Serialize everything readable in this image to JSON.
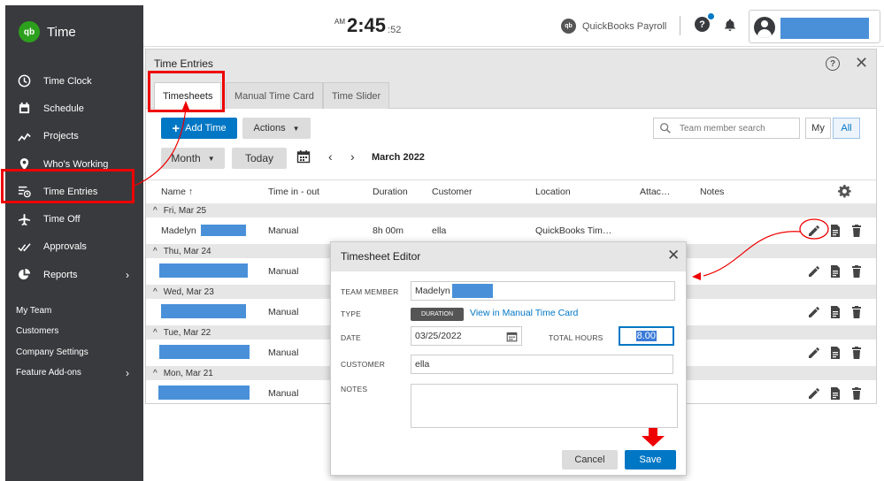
{
  "brand": {
    "logo": "qb",
    "name": "Time"
  },
  "sidebar": {
    "items": [
      {
        "label": "Time Clock",
        "icon": "clock-icon"
      },
      {
        "label": "Schedule",
        "icon": "calendar-icon"
      },
      {
        "label": "Projects",
        "icon": "projects-icon"
      },
      {
        "label": "Who's Working",
        "icon": "location-pin-icon"
      },
      {
        "label": "Time Entries",
        "icon": "time-entries-icon"
      },
      {
        "label": "Time Off",
        "icon": "plane-icon"
      },
      {
        "label": "Approvals",
        "icon": "approvals-icon"
      },
      {
        "label": "Reports",
        "icon": "pie-chart-icon",
        "chevron": "›"
      }
    ],
    "sub_items": [
      {
        "label": "My Team"
      },
      {
        "label": "Customers"
      },
      {
        "label": "Company Settings"
      },
      {
        "label": "Feature Add-ons",
        "chevron": "›"
      }
    ]
  },
  "header": {
    "ampm": "AM",
    "time": "2:45",
    "seconds": ":52",
    "payroll_logo": "qb",
    "payroll": "QuickBooks Payroll",
    "help": "?"
  },
  "panel": {
    "title": "Time Entries",
    "help": "?",
    "close": "✕",
    "tabs": [
      "Timesheets",
      "Manual Time Card",
      "Time Slider"
    ],
    "add_time": "Add Time",
    "add_plus": "+",
    "actions": "Actions",
    "search_placeholder": "Team member search",
    "toggle_my": "My",
    "toggle_all": "All",
    "period": "Month",
    "today": "Today",
    "prev": "‹",
    "next": "›",
    "month_label": "March 2022",
    "columns": [
      "Name ↑",
      "Time in - out",
      "Duration",
      "Customer",
      "Location",
      "Attac…",
      "Notes"
    ],
    "groups": [
      {
        "date": "Fri, Mar 25",
        "name": "Madelyn",
        "type": "Manual",
        "duration": "8h 00m",
        "customer": "ella",
        "location": "QuickBooks Tim…"
      },
      {
        "date": "Thu, Mar 24",
        "name": "",
        "type": "Manual",
        "duration": "",
        "customer": "",
        "location": ""
      },
      {
        "date": "Wed, Mar 23",
        "name": "",
        "type": "Manual",
        "duration": "",
        "customer": "",
        "location": ""
      },
      {
        "date": "Tue, Mar 22",
        "name": "",
        "type": "Manual",
        "duration": "",
        "customer": "",
        "location": ""
      },
      {
        "date": "Mon, Mar 21",
        "name": "",
        "type": "Manual",
        "duration": "",
        "customer": "",
        "location": ""
      }
    ],
    "caret_up": "^"
  },
  "editor": {
    "title": "Timesheet Editor",
    "close": "✕",
    "team_member_label": "TEAM MEMBER",
    "team_member_value": "Madelyn",
    "type_label": "TYPE",
    "type_badge": "DURATION",
    "type_link": "View in Manual Time Card",
    "date_label": "DATE",
    "date_value": "03/25/2022",
    "total_hours_label": "TOTAL HOURS",
    "total_hours_value": "8.00",
    "customer_label": "CUSTOMER",
    "customer_value": "ella",
    "notes_label": "NOTES",
    "notes_value": "",
    "cancel": "Cancel",
    "save": "Save"
  },
  "colors": {
    "sidebar_bg": "#393a3d",
    "brand_green": "#2ca01c",
    "primary_blue": "#0077c5",
    "redaction_blue": "#4a90d9",
    "annotation_red": "#e00000"
  }
}
